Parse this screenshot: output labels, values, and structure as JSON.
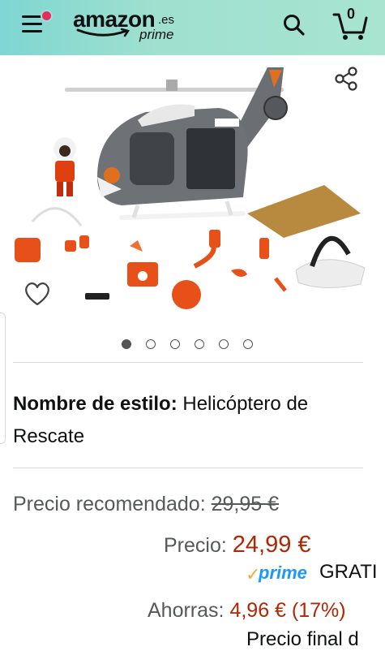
{
  "header": {
    "logo_word": "amazon",
    "logo_tld": ".es",
    "logo_prime": "prime",
    "cart_count": "0"
  },
  "colors": {
    "header_bg": "#9fe0cf",
    "notification_dot": "#e8295f",
    "price_red": "#b12704",
    "prime_blue": "#1a98ff"
  },
  "icons": [
    "menu-icon",
    "search-icon",
    "cart-icon",
    "share-icon",
    "heart-icon"
  ],
  "gallery": {
    "total_images": 6,
    "active_index": 0
  },
  "product": {
    "style_label": "Nombre de estilo:",
    "style_value": "Helicóptero de Rescate"
  },
  "pricing": {
    "recommended_label": "Precio recomendado:",
    "recommended_value": "29,95 €",
    "price_label": "Precio:",
    "price_value": "24,99 €",
    "prime_text": "prime",
    "shipping": "GRATI",
    "savings_label": "Ahorras:",
    "savings_value": "4,96 € (17%)",
    "final_label": "Precio final d"
  }
}
